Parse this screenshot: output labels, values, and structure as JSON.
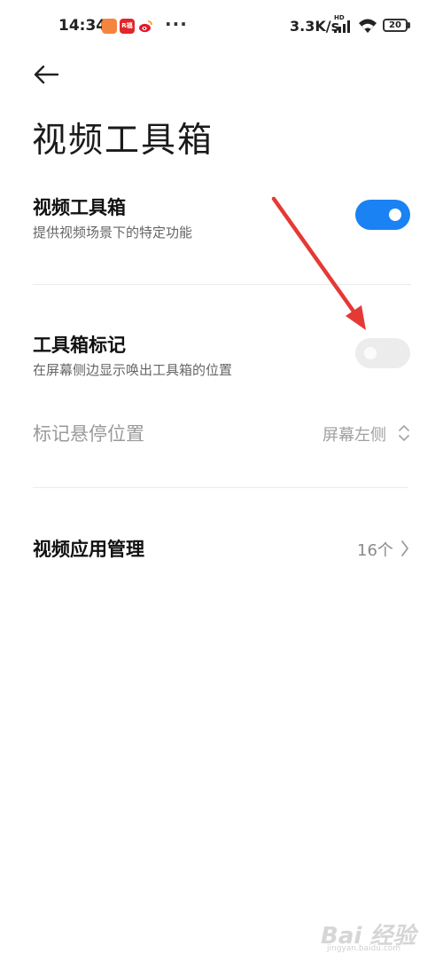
{
  "status_bar": {
    "time": "14:34",
    "net_speed": "3.3K/s",
    "hd": "HD",
    "battery": "20",
    "red_icon_text": "R福",
    "more": "···"
  },
  "header": {
    "title": "视频工具箱"
  },
  "settings": {
    "video_toolbox": {
      "title": "视频工具箱",
      "subtitle": "提供视频场景下的特定功能",
      "enabled": true
    },
    "toolbox_marker": {
      "title": "工具箱标记",
      "subtitle": "在屏幕侧边显示唤出工具箱的位置",
      "enabled": false
    },
    "marker_position": {
      "title": "标记悬停位置",
      "value": "屏幕左侧"
    },
    "video_apps": {
      "title": "视频应用管理",
      "value": "16个"
    }
  },
  "colors": {
    "toggle_on": "#1a82f2",
    "toggle_off": "#ececec",
    "annotation_arrow": "#e53935"
  },
  "watermark": {
    "logo": "Bai 经验",
    "domain": "jingyan.baidu.com"
  }
}
